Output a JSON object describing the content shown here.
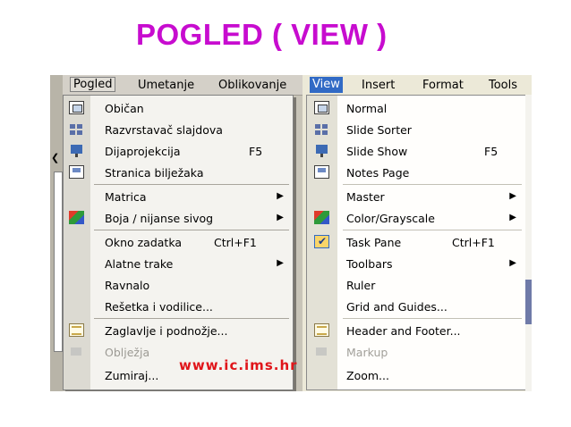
{
  "title": "POGLED ( VIEW )",
  "watermark": "www.ic.ims.hr",
  "left": {
    "menubar": [
      "Pogled",
      "Umetanje",
      "Oblikovanje"
    ],
    "items": [
      {
        "label": "Običan",
        "icon": "normal-view-icon"
      },
      {
        "label": "Razvrstavač slajdova",
        "icon": "slide-sorter-icon"
      },
      {
        "label": "Dijaprojekcija",
        "shortcut": "F5",
        "icon": "slide-show-icon"
      },
      {
        "label": "Stranica bilježaka",
        "icon": "notes-page-icon"
      },
      {
        "label": "Matrica",
        "submenu": true
      },
      {
        "label": "Boja / nijanse sivog",
        "submenu": true,
        "icon": "color-grayscale-icon"
      },
      {
        "label": "Okno zadatka",
        "shortcut": "Ctrl+F1"
      },
      {
        "label": "Alatne trake",
        "submenu": true
      },
      {
        "label": "Ravnalo"
      },
      {
        "label": "Rešetka i vodilice..."
      },
      {
        "label": "Zaglavlje i podnožje...",
        "icon": "header-footer-icon"
      },
      {
        "label": "Oblježja",
        "disabled": true,
        "icon": "markup-icon"
      },
      {
        "label": "Zumiraj..."
      }
    ]
  },
  "right": {
    "menubar": [
      "View",
      "Insert",
      "Format",
      "Tools"
    ],
    "items": [
      {
        "label": "Normal",
        "icon": "normal-view-icon"
      },
      {
        "label": "Slide Sorter",
        "icon": "slide-sorter-icon"
      },
      {
        "label": "Slide Show",
        "shortcut": "F5",
        "icon": "slide-show-icon"
      },
      {
        "label": "Notes Page",
        "icon": "notes-page-icon"
      },
      {
        "label": "Master",
        "submenu": true
      },
      {
        "label": "Color/Grayscale",
        "submenu": true,
        "icon": "color-grayscale-icon"
      },
      {
        "label": "Task Pane",
        "shortcut": "Ctrl+F1",
        "checked": true,
        "icon": "check-icon"
      },
      {
        "label": "Toolbars",
        "submenu": true
      },
      {
        "label": "Ruler"
      },
      {
        "label": "Grid and Guides..."
      },
      {
        "label": "Header and Footer...",
        "icon": "header-footer-icon"
      },
      {
        "label": "Markup",
        "disabled": true,
        "icon": "markup-icon"
      },
      {
        "label": "Zoom..."
      }
    ]
  },
  "submenu_glyph": "▶",
  "colors": {
    "title": "#c70ccf",
    "watermark": "#e0151a",
    "xp_highlight": "#316ac5"
  }
}
